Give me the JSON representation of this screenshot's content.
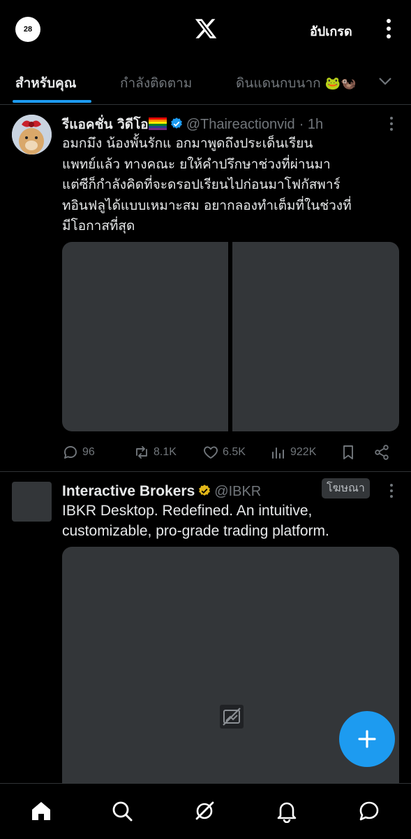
{
  "header": {
    "avatar_text": "28",
    "logo": "x-logo-icon",
    "upgrade_label": "อัปเกรด",
    "more": "more-vertical-icon"
  },
  "tabs": [
    {
      "label": "สำหรับคุณ",
      "active": true
    },
    {
      "label": "กำลังติดตาม",
      "active": false
    },
    {
      "label": "ดินแดนกบนาก",
      "emoji": "🐸🦦",
      "active": false
    }
  ],
  "posts": [
    {
      "name": "รีแอคชั่น วิดีโอ",
      "handle": "@Thaireactionvid",
      "time": "· 1h",
      "verified": true,
      "text": "อมกมึง น้องพั้นรักแ    อกมาพูดถึงประเด็นเรียน\nแพทย์แล้ว ทางคณะ   ยให้คำปรึกษาช่วงที่ผ่านมา\nแต่ซีก็กำลังคิดที่จะดรอปเรียนไปก่อนมาโฟกัสพาร์\nทอินฟลูได้แบบเหมาะสม อยากลองทำเต็มที่ในช่วงที่\nมีโอกาสที่สุด",
      "replies": "96",
      "reposts": "8.1K",
      "likes": "6.5K",
      "views": "922K"
    },
    {
      "name": "Interactive Brokers",
      "handle": "@IBKR",
      "ad_label": "โฆษณา",
      "verified": true,
      "text": "IBKR Desktop. Redefined. An intuitive,\ncustomizable, pro-grade trading platform."
    }
  ],
  "nav": [
    "home-icon",
    "search-icon",
    "grok-icon",
    "notifications-icon",
    "messages-icon"
  ],
  "colors": {
    "accent": "#1d9bf0",
    "gold": "#e2b719",
    "muted": "#71767b",
    "divider": "#2f3336"
  }
}
